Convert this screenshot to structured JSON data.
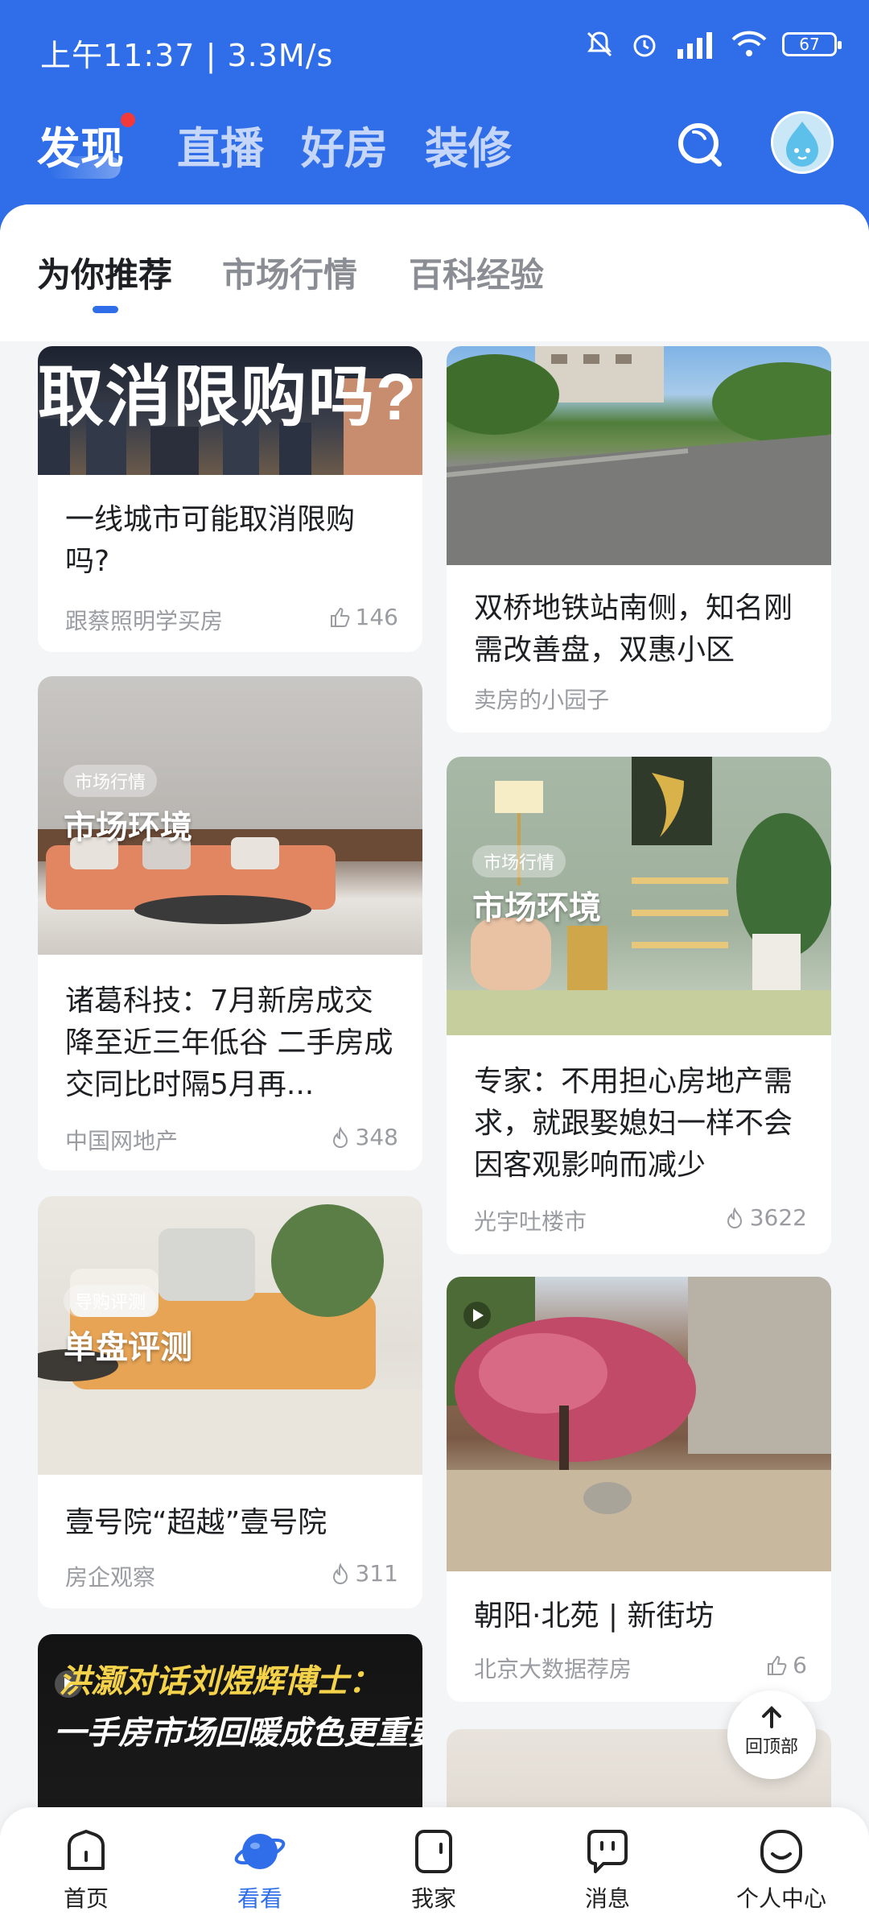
{
  "status_bar": {
    "time": "上午11:37 | 3.3M/s",
    "battery": "67"
  },
  "top_tabs": [
    "发现",
    "直播",
    "好房",
    "装修"
  ],
  "sub_tabs": [
    "为你推荐",
    "市场行情",
    "百科经验"
  ],
  "cards": [
    {
      "image_text": "取消限购吗?",
      "title": "一线城市可能取消限购吗?",
      "source": "跟蔡照明学买房",
      "likes": "146"
    },
    {
      "title": "双桥地铁站南侧，知名刚需改善盘，双惠小区",
      "source": "卖房的小园子"
    },
    {
      "tag_small": "市场行情",
      "tag_big": "市场环境",
      "title": "诸葛科技：7月新房成交降至近三年低谷 二手房成交同比时隔5月再...",
      "source": "中国网地产",
      "likes": "348"
    },
    {
      "tag_small": "市场行情",
      "tag_big": "市场环境",
      "title": "专家：不用担心房地产需求，就跟娶媳妇一样不会因客观影响而减少",
      "source": "光宇吐楼市",
      "likes": "3622"
    },
    {
      "tag_small": "导购评测",
      "tag_big": "单盘评测",
      "title": "壹号院“超越”壹号院",
      "source": "房企观察",
      "likes": "311"
    },
    {
      "title": "朝阳·北苑 | 新街坊",
      "source": "北京大数据荐房",
      "likes": "6"
    },
    {
      "image_line1": "洪灏对话刘煜辉博士：",
      "image_line2": "一手房市场回暖成色更重要"
    }
  ],
  "back_to_top": "回顶部",
  "bottom_nav": [
    "首页",
    "看看",
    "我家",
    "消息",
    "个人中心"
  ],
  "colors": {
    "brand": "#2f6ee8",
    "badge": "#f23a3a"
  }
}
